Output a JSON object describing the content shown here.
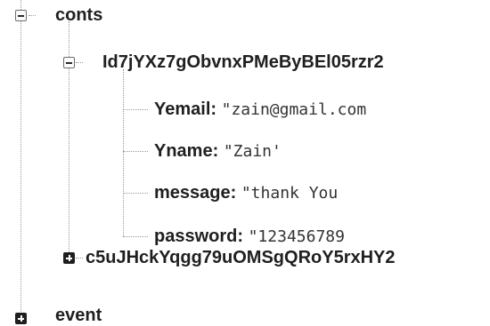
{
  "tree": {
    "conts": {
      "label": "conts",
      "children": {
        "entry1": {
          "key": "Id7jYXz7gObvnxPMeByBEl05rzr2",
          "fields": [
            {
              "key": "Yemail:",
              "value": "\"zain@gmail.com"
            },
            {
              "key": "Yname:",
              "value": "\"Zain'"
            },
            {
              "key": "message:",
              "value": "\"thank You"
            },
            {
              "key": "password:",
              "value": "\"123456789"
            }
          ]
        },
        "entry2": {
          "key": "c5uJHckYqgg79uOMSgQRoY5rxHY2"
        }
      }
    },
    "event": {
      "label": "event"
    }
  },
  "icons": {
    "expanded": "minus-box-icon",
    "collapsed": "plus-box-icon"
  }
}
